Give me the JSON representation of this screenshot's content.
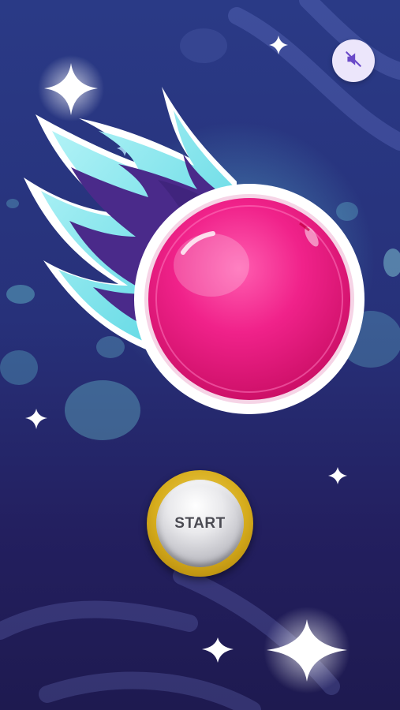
{
  "game": {
    "start_label": "START"
  },
  "controls": {
    "mute_icon": "speaker-muted-icon"
  },
  "colors": {
    "background_top": "#2a3a86",
    "background_bottom": "#1e1a50",
    "ball_pink": "#e8197a",
    "flame_cyan": "#63e6ec",
    "flame_purple": "#4a2a8a",
    "button_gold": "#d6ac1c",
    "button_silver": "#d9d9de",
    "mute_bg": "#ece6fb"
  }
}
